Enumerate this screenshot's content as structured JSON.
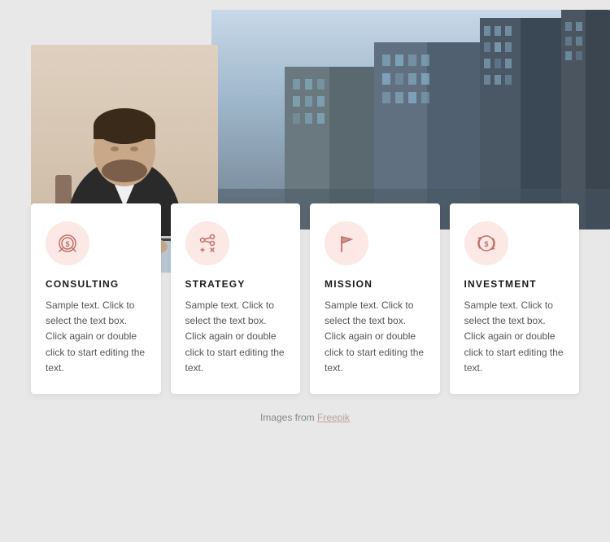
{
  "images": {
    "person_alt": "Business person working on laptop",
    "city_alt": "City buildings"
  },
  "cards": [
    {
      "id": "consulting",
      "title": "CONSULTING",
      "icon": "consulting-icon",
      "text": "Sample text. Click to select the text box. Click again or double click to start editing the text."
    },
    {
      "id": "strategy",
      "title": "STRATEGY",
      "icon": "strategy-icon",
      "text": "Sample text. Click to select the text box. Click again or double click to start editing the text."
    },
    {
      "id": "mission",
      "title": "MISSION",
      "icon": "mission-icon",
      "text": "Sample text. Click to select the text box. Click again or double click to start editing the text."
    },
    {
      "id": "investment",
      "title": "INVESTMENT",
      "icon": "investment-icon",
      "text": "Sample text. Click to select the text box. Click again or double click to start editing the text."
    }
  ],
  "footer": {
    "text": "Images from ",
    "link_label": "Freepik"
  }
}
